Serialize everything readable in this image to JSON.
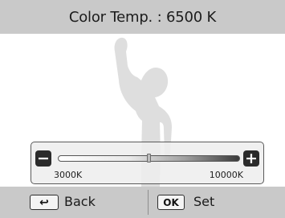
{
  "header": {
    "title": "Color Temp. : 6500 K"
  },
  "slider": {
    "value_kelvin": 6500,
    "min_kelvin": 3000,
    "max_kelvin": 10000,
    "min_label": "3000K",
    "max_label": "10000K",
    "minus_icon": "minus-icon",
    "plus_icon": "plus-icon",
    "minus_glyph": "−",
    "plus_glyph": "+"
  },
  "footer": {
    "back_label": "Back",
    "back_icon": "return-arrow-icon",
    "back_glyph": "↩",
    "set_key": "OK",
    "set_label": "Set"
  },
  "colors": {
    "bar_bg": "#c9c9c9",
    "silhouette": "#dedede",
    "control_dark": "#2b2b2b"
  }
}
